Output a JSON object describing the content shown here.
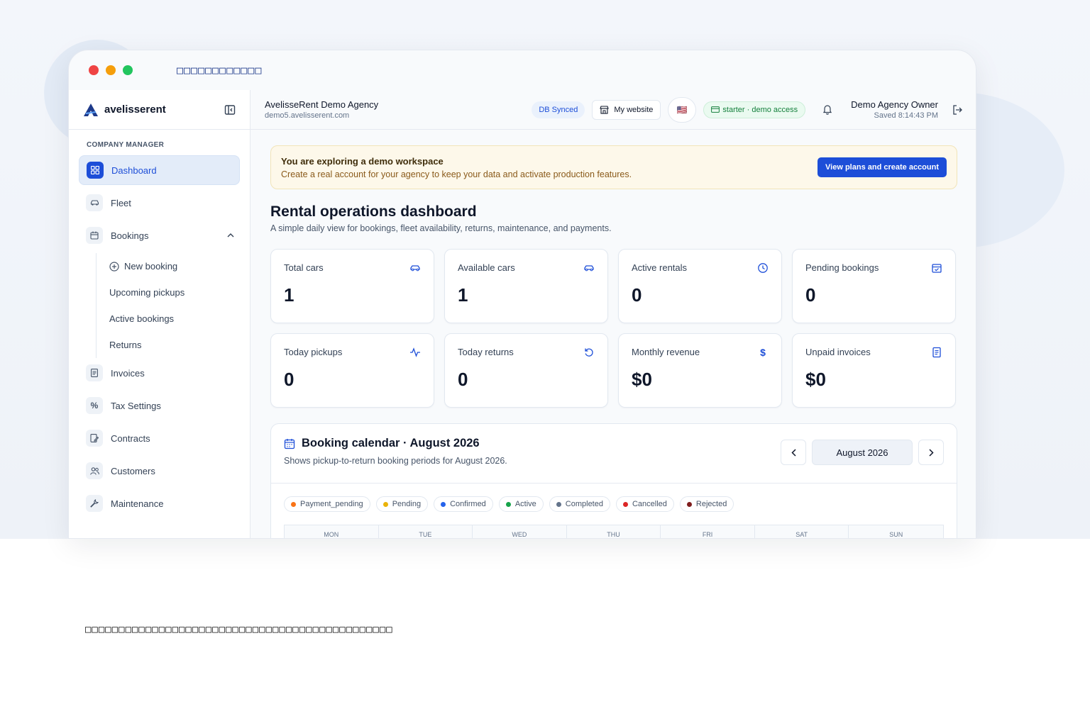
{
  "window": {
    "title": "□□□□□□□□□□□□"
  },
  "brand": {
    "name": "avelisserent"
  },
  "sidebar": {
    "section_label": "COMPANY MANAGER",
    "items": [
      {
        "label": "Dashboard",
        "icon": "grid-icon",
        "active": true
      },
      {
        "label": "Fleet",
        "icon": "car-icon"
      },
      {
        "label": "Bookings",
        "icon": "calendar-icon",
        "expanded": true
      },
      {
        "label": "Invoices",
        "icon": "document-icon"
      },
      {
        "label": "Tax Settings",
        "icon": "percent-icon"
      },
      {
        "label": "Contracts",
        "icon": "contract-icon"
      },
      {
        "label": "Customers",
        "icon": "users-icon"
      },
      {
        "label": "Maintenance",
        "icon": "wrench-icon"
      }
    ],
    "bookings_sub": [
      {
        "label": "New booking",
        "icon": "plus-circle-icon"
      },
      {
        "label": "Upcoming pickups"
      },
      {
        "label": "Active bookings"
      },
      {
        "label": "Returns"
      }
    ]
  },
  "topbar": {
    "agency_name": "AvelisseRent Demo Agency",
    "agency_domain": "demo5.avelisserent.com",
    "db_status": "DB Synced",
    "website_label": "My website",
    "flag": "🇺🇸",
    "plan_label": "starter · demo access",
    "user_name": "Demo Agency Owner",
    "saved_text": "Saved 8:14:43 PM"
  },
  "banner": {
    "title": "You are exploring a demo workspace",
    "subtitle": "Create a real account for your agency to keep your data and activate production features.",
    "button": "View plans and create account"
  },
  "page": {
    "title": "Rental operations dashboard",
    "subtitle": "A simple daily view for bookings, fleet availability, returns, maintenance, and payments."
  },
  "cards": [
    {
      "label": "Total cars",
      "value": "1",
      "icon": "car-icon"
    },
    {
      "label": "Available cars",
      "value": "1",
      "icon": "car-icon"
    },
    {
      "label": "Active rentals",
      "value": "0",
      "icon": "clock-icon"
    },
    {
      "label": "Pending bookings",
      "value": "0",
      "icon": "calendar-check-icon"
    },
    {
      "label": "Today pickups",
      "value": "0",
      "icon": "activity-icon"
    },
    {
      "label": "Today returns",
      "value": "0",
      "icon": "rotate-icon"
    },
    {
      "label": "Monthly revenue",
      "value": "$0",
      "icon": "dollar-icon"
    },
    {
      "label": "Unpaid invoices",
      "value": "$0",
      "icon": "document-icon"
    }
  ],
  "calendar": {
    "title": "Booking calendar · August 2026",
    "subtitle": "Shows pickup-to-return booking periods for August 2026.",
    "month_label": "August 2026",
    "legend": [
      {
        "label": "Payment_pending",
        "color": "#f97316"
      },
      {
        "label": "Pending",
        "color": "#eab308"
      },
      {
        "label": "Confirmed",
        "color": "#2563eb"
      },
      {
        "label": "Active",
        "color": "#16a34a"
      },
      {
        "label": "Completed",
        "color": "#64748b"
      },
      {
        "label": "Cancelled",
        "color": "#dc2626"
      },
      {
        "label": "Rejected",
        "color": "#7f1d1d"
      }
    ],
    "weekdays": [
      "MON",
      "TUE",
      "WED",
      "THU",
      "FRI",
      "SAT",
      "SUN"
    ]
  },
  "footer_note": "□□□□□□□□□□□□□□□□□□□□□□□□□□□□□□□□□□□□□□□□□□□□□□"
}
